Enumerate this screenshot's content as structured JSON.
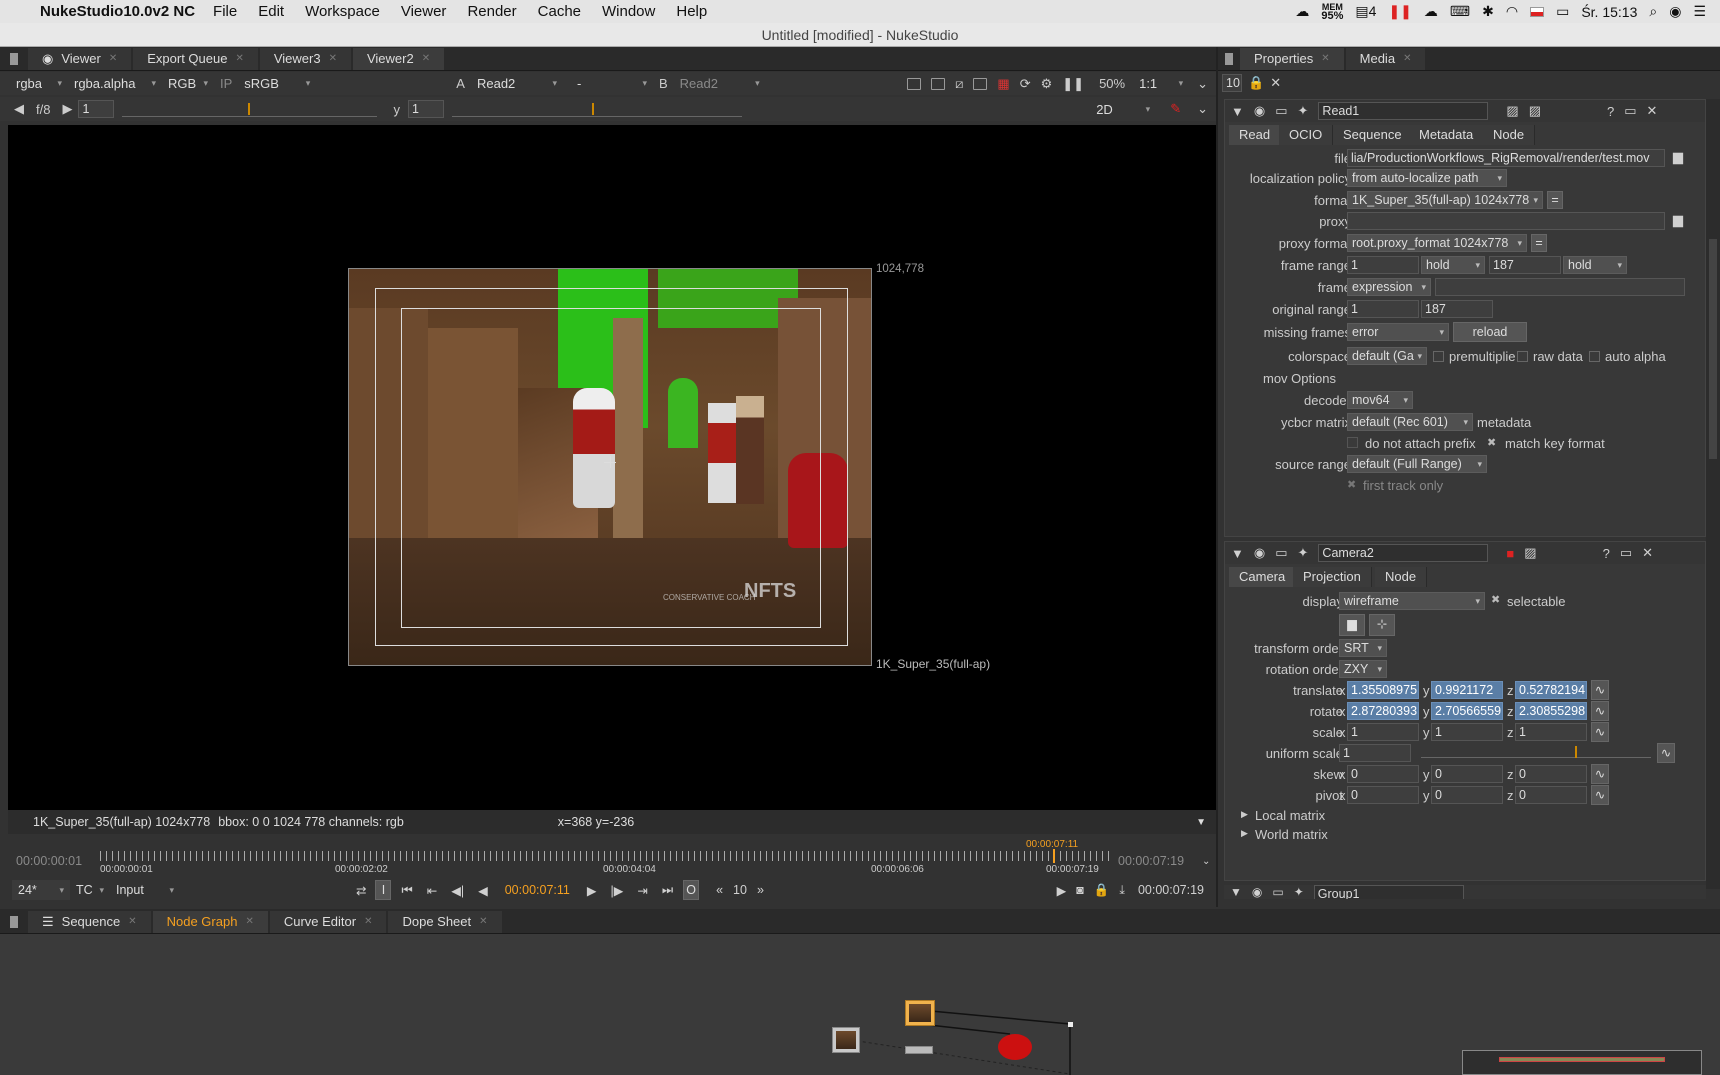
{
  "menubar": {
    "app_name": "NukeStudio10.0v2 NC",
    "items": [
      "File",
      "Edit",
      "Workspace",
      "Viewer",
      "Render",
      "Cache",
      "Window",
      "Help"
    ],
    "mem_label": "MEM",
    "mem_value": "95%",
    "badge_count": "4",
    "clock": "Śr. 15:13"
  },
  "window_title": "Untitled [modified] - NukeStudio",
  "viewer_tabs": [
    {
      "label": "Viewer"
    },
    {
      "label": "Export Queue"
    },
    {
      "label": "Viewer3"
    },
    {
      "label": "Viewer2"
    }
  ],
  "viewer_toolbar": {
    "channels": "rgba",
    "alpha": "rgba.alpha",
    "display": "RGB",
    "ip": "IP",
    "lut": "sRGB",
    "a_label": "A",
    "a_input": "Read2",
    "op": "-",
    "b_label": "B",
    "b_input": "Read2",
    "zoom": "50%",
    "ratio": "1:1"
  },
  "viewer_toolbar2": {
    "fstop": "f/8",
    "gain_value": "1",
    "y_label": "y",
    "gamma_value": "1",
    "mode": "2D"
  },
  "viewer_overlays": {
    "top_right": "1024,778",
    "format_label": "1K_Super_35(full-ap)",
    "watermark": "NFTS",
    "watermark_sub": "CONSERVATIVE COACH"
  },
  "viewer_info": {
    "format": "1K_Super_35(full-ap) 1024x778",
    "bbox": "bbox: 0 0 1024 778 channels: rgb",
    "coords": "x=368 y=-236"
  },
  "timeline": {
    "start": "00:00:00:01",
    "end": "00:00:07:19",
    "current_marker": "00:00:07:11",
    "ticks": [
      "00:00:00:01",
      "00:00:02:02",
      "00:00:04:04",
      "00:00:06:06",
      "00:00:07:19"
    ]
  },
  "playback": {
    "fps": "24*",
    "tc_mode": "TC",
    "input_mode": "Input",
    "current_tc": "00:00:07:11",
    "step": "10",
    "out_tc": "00:00:07:19",
    "in_btn": "I",
    "out_btn": "O"
  },
  "properties_tabs": [
    {
      "label": "Properties"
    },
    {
      "label": "Media"
    }
  ],
  "properties_toolbar": {
    "max_panels": "10"
  },
  "read_node": {
    "name": "Read1",
    "tabs": [
      "Read",
      "OCIO",
      "Sequence",
      "Metadata",
      "Node"
    ],
    "labels": {
      "file": "file",
      "localization": "localization policy",
      "format": "format",
      "proxy": "proxy",
      "proxy_format": "proxy format",
      "frame_range": "frame range",
      "frame": "frame",
      "original_range": "original range",
      "missing_frames": "missing frames",
      "colorspace": "colorspace",
      "mov_options": "mov Options",
      "decoder": "decoder",
      "ycbcr": "ycbcr matrix",
      "source_range": "source range"
    },
    "file": "lia/ProductionWorkflows_RigRemoval/render/test.mov",
    "localization": "from auto-localize path",
    "format": "1K_Super_35(full-ap) 1024x778",
    "proxy_format": "root.proxy_format 1024x778",
    "frame_first": "1",
    "frame_before": "hold",
    "frame_last": "187",
    "frame_after": "hold",
    "frame_mode": "expression",
    "orig_first": "1",
    "orig_last": "187",
    "missing": "error",
    "reload": "reload",
    "colorspace": "default (Ga",
    "premultiplied": "premultiplie",
    "raw_data": "raw data",
    "auto_alpha": "auto alpha",
    "decoder": "mov64",
    "ycbcr": "default (Rec 601)",
    "metadata": "metadata",
    "no_prefix": "do not attach prefix",
    "match_key": "match key format",
    "source_range": "default (Full Range)",
    "first_track": "first track only"
  },
  "camera_node": {
    "name": "Camera2",
    "tabs": [
      "Camera",
      "Projection",
      "Node"
    ],
    "labels": {
      "display": "display",
      "transform_order": "transform order",
      "rotation_order": "rotation order",
      "translate": "translate",
      "rotate": "rotate",
      "scale": "scale",
      "uniform_scale": "uniform scale",
      "skew": "skew",
      "pivot": "pivot"
    },
    "display": "wireframe",
    "selectable": "selectable",
    "transform_order": "SRT",
    "rotation_order": "ZXY",
    "axis": {
      "x": "x",
      "y": "y",
      "z": "z"
    },
    "translate": [
      "1.35508975",
      "0.9921172",
      "0.52782194"
    ],
    "rotate": [
      "2.87280393",
      "2.70566559",
      "2.30855298"
    ],
    "scale": [
      "1",
      "1",
      "1"
    ],
    "uniform_scale": "1",
    "skew": [
      "0",
      "0",
      "0"
    ],
    "pivot": [
      "0",
      "0",
      "0"
    ],
    "local_matrix": "Local matrix",
    "world_matrix": "World matrix"
  },
  "group_node": {
    "name": "Group1"
  },
  "bottom_tabs": [
    {
      "label": "Sequence"
    },
    {
      "label": "Node Graph"
    },
    {
      "label": "Curve Editor"
    },
    {
      "label": "Dope Sheet"
    }
  ]
}
